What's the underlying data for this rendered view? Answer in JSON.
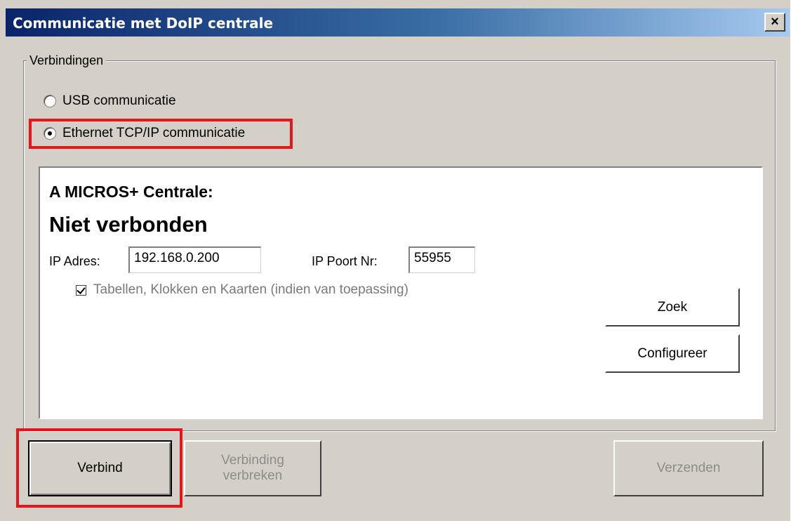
{
  "window": {
    "title": "Communicatie met DoIP centrale",
    "close_symbol": "×"
  },
  "connections": {
    "group_label": "Verbindingen",
    "options": [
      {
        "label": "USB communicatie",
        "selected": false
      },
      {
        "label": "Ethernet TCP/IP communicatie",
        "selected": true
      }
    ]
  },
  "panel": {
    "device_name": "A MICROS+ Centrale:",
    "status": "Niet verbonden",
    "ip_address_label": "IP Adres:",
    "ip_address_value": "192.168.0.200",
    "ip_port_label": "IP Poort Nr:",
    "ip_port_value": "55955",
    "checkbox_label": "Tabellen, Klokken en Kaarten (indien van toepassing)",
    "checkbox_checked": true,
    "search_button": "Zoek",
    "configure_button": "Configureer"
  },
  "footer": {
    "connect_button": "Verbind",
    "disconnect_button_line1": "Verbinding",
    "disconnect_button_line2": "verbreken",
    "send_button": "Verzenden"
  },
  "colors": {
    "title_gradient_start": "#0a246a",
    "title_gradient_end": "#a6caf0",
    "highlight": "#e8141c",
    "window_face": "#d4d0c8"
  }
}
